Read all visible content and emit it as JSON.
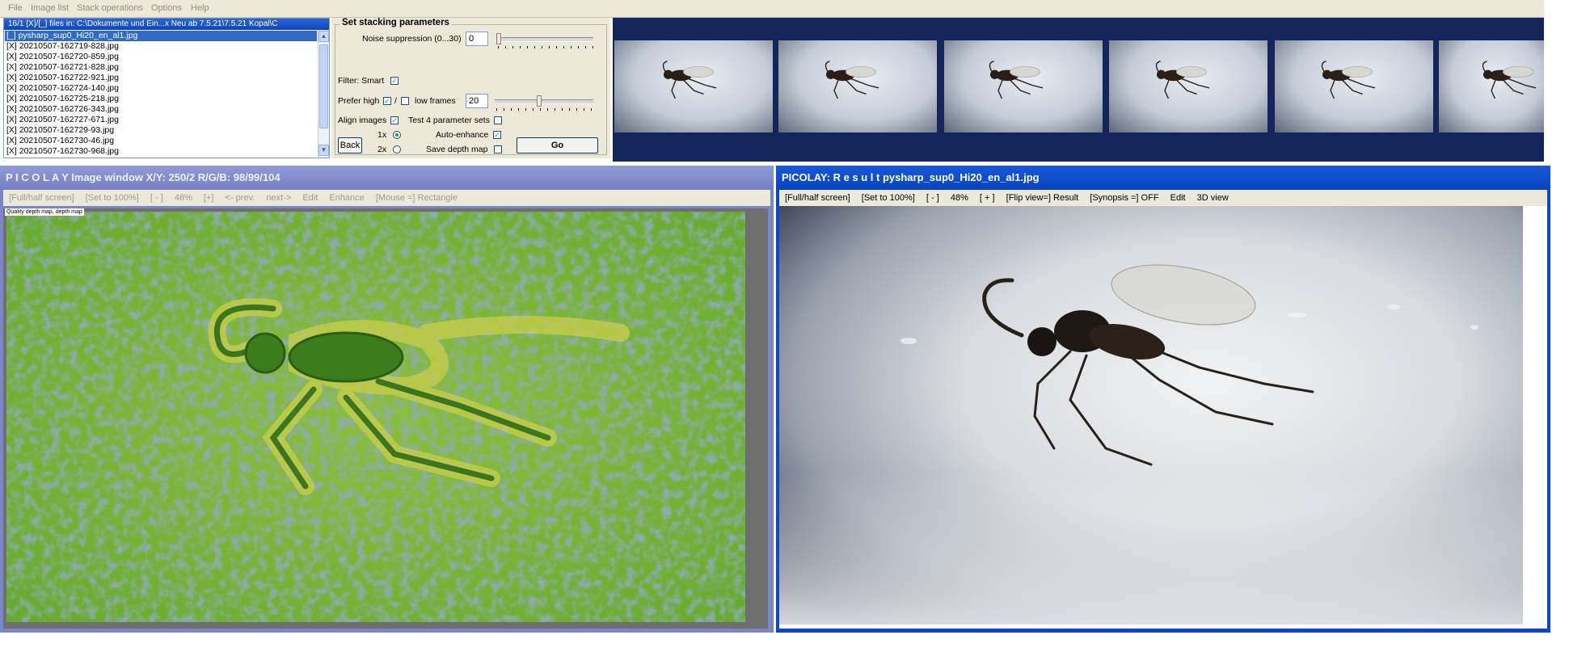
{
  "menubar": {
    "items": [
      "File",
      "Image list",
      "Stack operations",
      "Options",
      "Help"
    ]
  },
  "file_list": {
    "header": "16/1 [X]/[_] files in: C:\\Dokumente und Ein...x Neu ab 7.5.21\\7.5.21 Kopal\\C",
    "items": [
      "[_] pysharp_sup0_Hi20_en_al1.jpg",
      "[X] 20210507-162719-828.jpg",
      "[X] 20210507-162720-859.jpg",
      "[X] 20210507-162721-828.jpg",
      "[X] 20210507-162722-921.jpg",
      "[X] 20210507-162724-140.jpg",
      "[X] 20210507-162725-218.jpg",
      "[X] 20210507-162726-343.jpg",
      "[X] 20210507-162727-671.jpg",
      "[X] 20210507-162729-93.jpg",
      "[X] 20210507-162730-46.jpg",
      "[X] 20210507-162730-968.jpg"
    ]
  },
  "params": {
    "title": "Set stacking parameters",
    "noise_label": "Noise suppression (0...30)",
    "noise_value": "0",
    "filter_label": "Filter: Smart",
    "prefer_label": "Prefer high",
    "slash": "/",
    "low_frames_label": "low frames",
    "frames_value": "20",
    "align_label": "Align images",
    "test_label": "Test 4 parameter sets",
    "one_x": "1x",
    "two_x": "2x",
    "auto_enhance_label": "Auto-enhance",
    "save_depth_label": "Save depth map",
    "back_label": "Back",
    "go_label": "Go",
    "check_mark": "✓"
  },
  "left_window": {
    "title": "P I C O L A Y   Image window X/Y:  250/2 R/G/B:  98/99/104",
    "toolbar": [
      "[Full/half screen]",
      "[Set to 100%]",
      "[ - ]",
      "48%",
      "[+]",
      "<- prev.",
      "next->",
      "Edit",
      "Enhance",
      "[Mouse =] Rectangle"
    ],
    "depth_tag": "Quality depth map, depth map"
  },
  "right_window": {
    "title": "PICOLAY: R e s u l t  pysharp_sup0_Hi20_en_al1.jpg",
    "toolbar": [
      "[Full/half screen]",
      "[Set to 100%]",
      "[ - ]",
      "48%",
      "[ + ]",
      "[Flip view=] Result",
      "[Synopsis =] OFF",
      "Edit",
      "3D view"
    ]
  }
}
